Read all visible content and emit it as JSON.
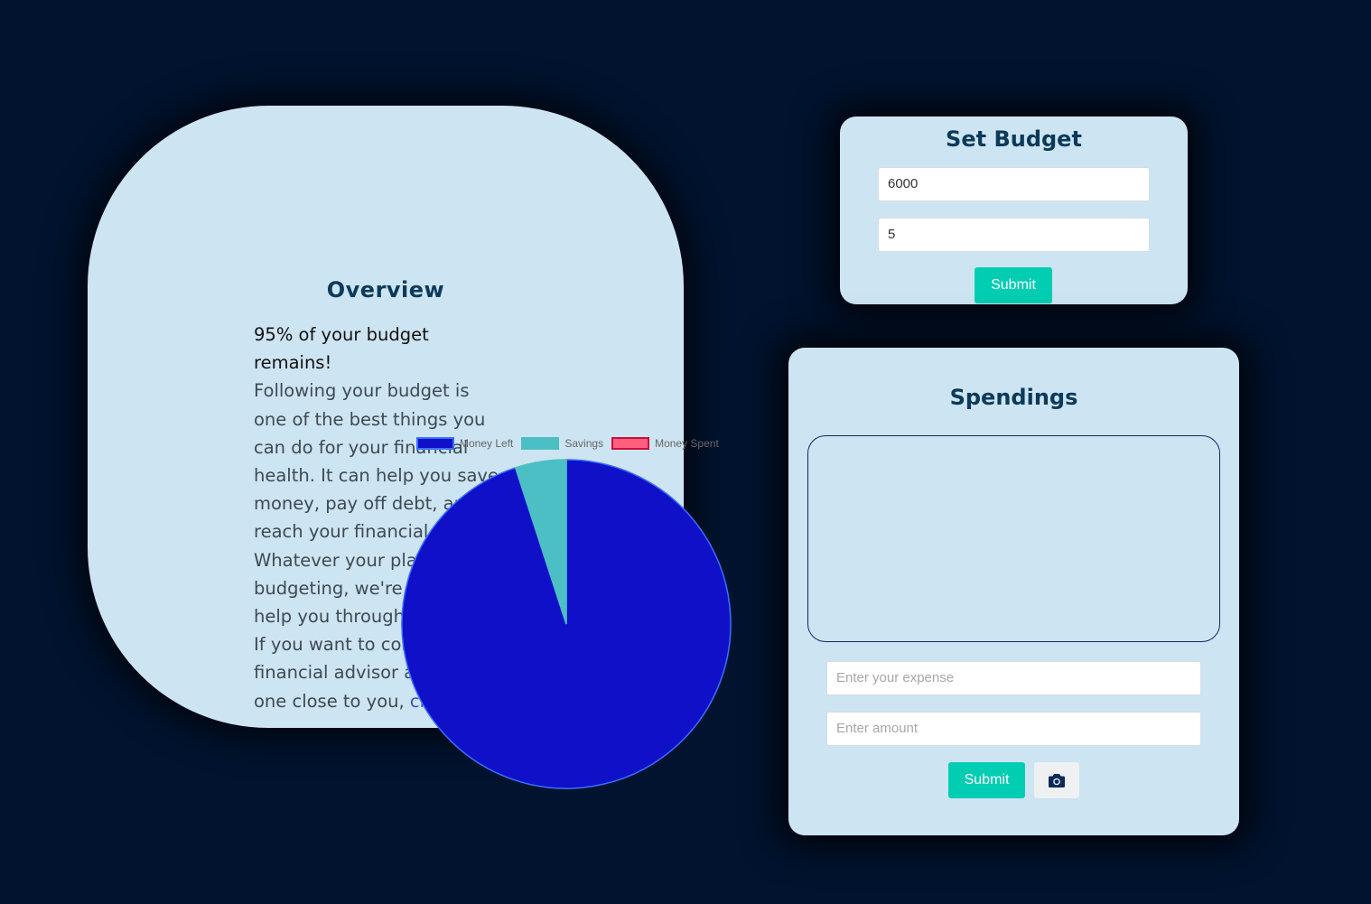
{
  "overview": {
    "title": "Overview",
    "remaining_text": "95% of your budget remains!",
    "body_text": "Following your budget is one of the best things you can do for your financial health. It can help you save money, pay off debt, and reach your financial goals. Whatever your plans for budgeting, we're here to help you through the way!",
    "contact_text": "If you want to contact a financial advisor and find one close to you, ",
    "contact_link": "click here!"
  },
  "chart_data": {
    "type": "pie",
    "categories": [
      "Money Left",
      "Savings",
      "Money Spent"
    ],
    "values": [
      95,
      5,
      0
    ],
    "colors": [
      "#1010c8",
      "#4bbfc3",
      "#ff5f7e"
    ],
    "border_colors": [
      "#3a70ff",
      "#4bbfc3",
      "#c8103a"
    ],
    "legend_position": "top"
  },
  "budget": {
    "title": "Set Budget",
    "budget_value": "6000",
    "savings_value": "5",
    "submit_label": "Submit"
  },
  "spendings": {
    "title": "Spendings",
    "expense_placeholder": "Enter your expense",
    "amount_placeholder": "Enter amount",
    "submit_label": "Submit",
    "camera_icon": "camera-icon"
  }
}
